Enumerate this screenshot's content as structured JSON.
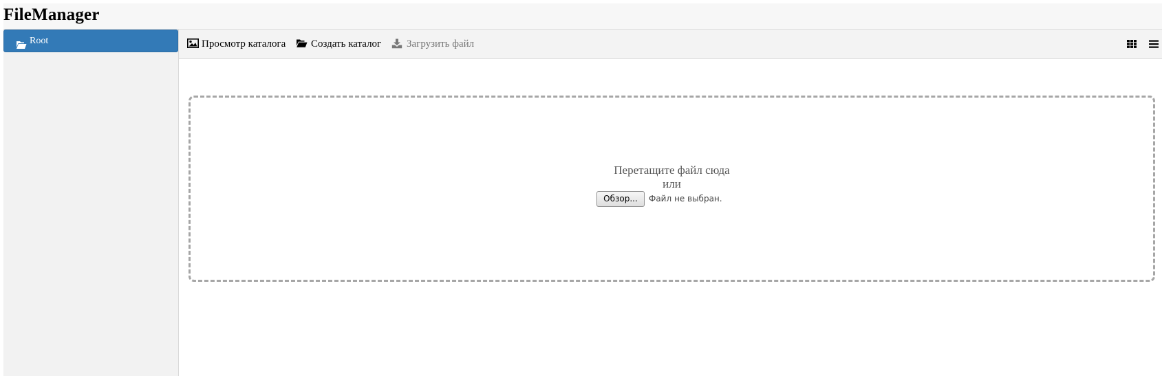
{
  "app": {
    "title": "FileManager"
  },
  "sidebar": {
    "items": [
      {
        "label": "Root",
        "icon": "folder-open-icon",
        "selected": true
      }
    ]
  },
  "toolbar": {
    "view_catalog_label": "Просмотр каталога",
    "view_catalog_icon": "image-icon",
    "create_catalog_label": "Создать каталог",
    "create_catalog_icon": "folder-open-icon",
    "upload_file_label": "Загрузить файл",
    "upload_file_icon": "download-icon",
    "upload_file_enabled": false,
    "grid_view_icon": "grid-icon",
    "list_view_icon": "list-icon"
  },
  "dropzone": {
    "prompt": "Перетащите файл сюда",
    "or": "или",
    "browse_label": "Обзор...",
    "file_status": "Файл не выбран."
  },
  "colors": {
    "accent": "#337ab7",
    "toolbar_bg": "#f3f3f3",
    "sidebar_bg": "#f2f2f2",
    "dropzone_border": "#a6a6a6"
  }
}
